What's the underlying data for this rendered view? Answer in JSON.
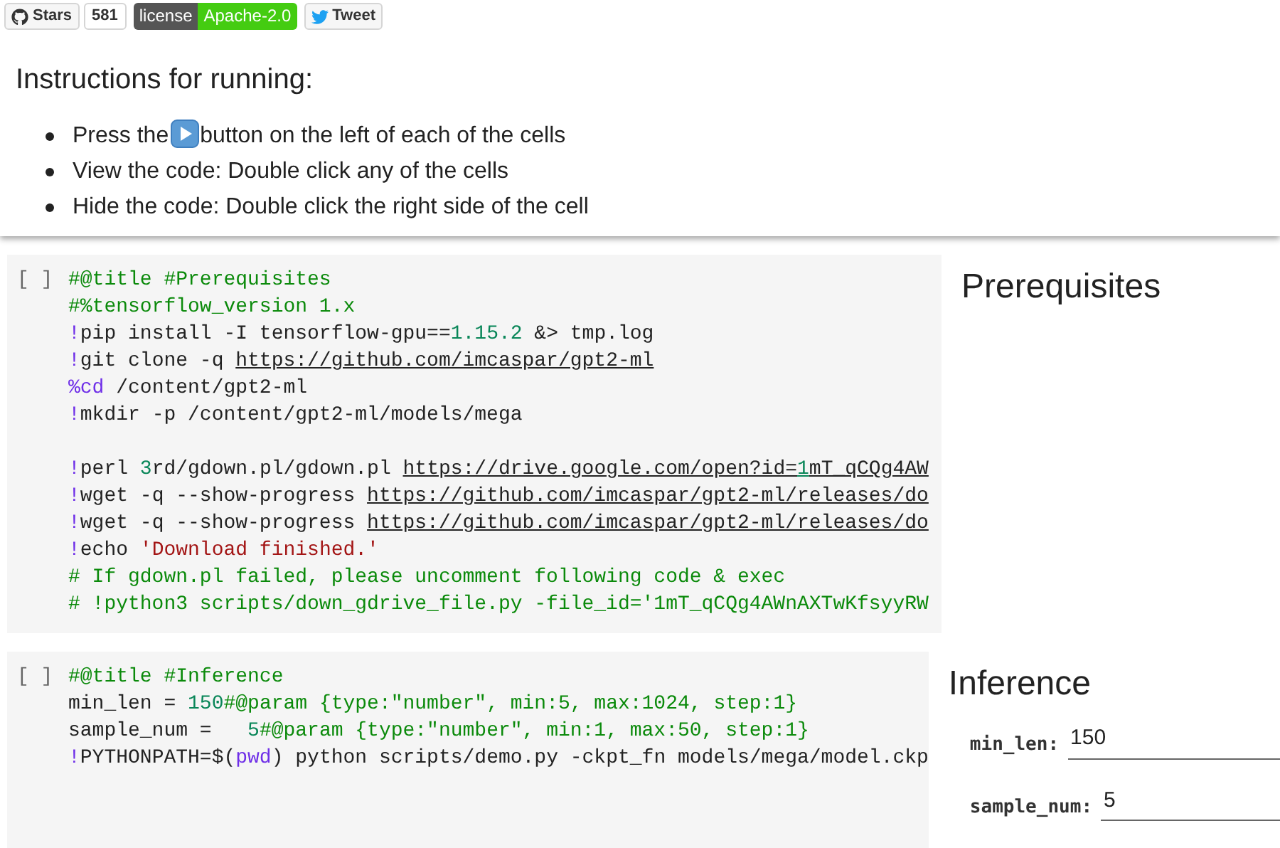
{
  "badges": {
    "stars_label": "Stars",
    "stars_count": "581",
    "license_label": "license",
    "license_value": "Apache-2.0",
    "tweet_label": "Tweet"
  },
  "instructions": {
    "heading": "Instructions for running:",
    "items": [
      {
        "kind": "with_icon",
        "before": "Press the",
        "after": "button on the left of each of the cells"
      },
      {
        "kind": "plain",
        "text": "View the code: Double click any of the cells"
      },
      {
        "kind": "plain",
        "text": "Hide the code: Double click the right side of the cell"
      }
    ]
  },
  "cells": [
    {
      "bracket": "[ ]",
      "title": "Prerequisites",
      "lines": [
        {
          "kind": "code",
          "tokens": [
            {
              "kind": "comment",
              "text": "#@title #Prerequisites"
            }
          ]
        },
        {
          "kind": "code",
          "tokens": [
            {
              "kind": "comment",
              "text": "#%tensorflow_version 1.x"
            }
          ]
        },
        {
          "kind": "code",
          "tokens": [
            {
              "kind": "keyword",
              "text": "!"
            },
            {
              "kind": "plain",
              "text": "pip install -I tensorflow-gpu=="
            },
            {
              "kind": "number",
              "text": "1.15.2"
            },
            {
              "kind": "plain",
              "text": " &> tmp.log"
            }
          ]
        },
        {
          "kind": "code",
          "tokens": [
            {
              "kind": "keyword",
              "text": "!"
            },
            {
              "kind": "plain",
              "text": "git clone -q "
            },
            {
              "kind": "link",
              "text": "https://github.com/imcaspar/gpt2-ml"
            }
          ]
        },
        {
          "kind": "code",
          "tokens": [
            {
              "kind": "keyword",
              "text": "%cd"
            },
            {
              "kind": "plain",
              "text": " /content/gpt2-ml"
            }
          ]
        },
        {
          "kind": "code",
          "tokens": [
            {
              "kind": "keyword",
              "text": "!"
            },
            {
              "kind": "plain",
              "text": "mkdir -p /content/gpt2-ml/models/mega"
            }
          ]
        },
        {
          "kind": "blank"
        },
        {
          "kind": "code",
          "tokens": [
            {
              "kind": "keyword",
              "text": "!"
            },
            {
              "kind": "plain",
              "text": "perl "
            },
            {
              "kind": "number",
              "text": "3"
            },
            {
              "kind": "plain",
              "text": "rd/gdown.pl/gdown.pl "
            },
            {
              "kind": "link",
              "text": "https://drive.google.com/open?id="
            },
            {
              "kind": "link_number",
              "text": "1"
            },
            {
              "kind": "link",
              "text": "mT_qCQg4AW"
            }
          ]
        },
        {
          "kind": "code",
          "tokens": [
            {
              "kind": "keyword",
              "text": "!"
            },
            {
              "kind": "plain",
              "text": "wget -q --show-progress "
            },
            {
              "kind": "link",
              "text": "https://github.com/imcaspar/gpt2-ml/releases/do"
            }
          ]
        },
        {
          "kind": "code",
          "tokens": [
            {
              "kind": "keyword",
              "text": "!"
            },
            {
              "kind": "plain",
              "text": "wget -q --show-progress "
            },
            {
              "kind": "link",
              "text": "https://github.com/imcaspar/gpt2-ml/releases/do"
            }
          ]
        },
        {
          "kind": "code",
          "tokens": [
            {
              "kind": "keyword",
              "text": "!"
            },
            {
              "kind": "plain",
              "text": "echo "
            },
            {
              "kind": "string",
              "text": "'Download finished.'"
            }
          ]
        },
        {
          "kind": "code",
          "tokens": [
            {
              "kind": "comment",
              "text": "# If gdown.pl failed, please uncomment following code & exec"
            }
          ]
        },
        {
          "kind": "code",
          "tokens": [
            {
              "kind": "comment",
              "text": "# !python3 scripts/down_gdrive_file.py -file_id='1mT_qCQg4AWnAXTwKfsyyRW"
            }
          ]
        }
      ]
    },
    {
      "bracket": "[ ]",
      "title": "Inference",
      "lines": [
        {
          "kind": "code",
          "tokens": [
            {
              "kind": "comment",
              "text": "#@title #Inference"
            }
          ]
        },
        {
          "kind": "code",
          "tokens": [
            {
              "kind": "plain",
              "text": "min_len = "
            },
            {
              "kind": "number",
              "text": "150"
            },
            {
              "kind": "comment",
              "text": "#@param {type:\"number\", min:5, max:1024, step:1}"
            }
          ]
        },
        {
          "kind": "code",
          "tokens": [
            {
              "kind": "plain",
              "text": "sample_num =   "
            },
            {
              "kind": "number",
              "text": "5"
            },
            {
              "kind": "comment",
              "text": "#@param {type:\"number\", min:1, max:50, step:1}"
            }
          ]
        },
        {
          "kind": "code",
          "tokens": [
            {
              "kind": "keyword",
              "text": "!"
            },
            {
              "kind": "plain",
              "text": "PYTHONPATH=$("
            },
            {
              "kind": "keyword",
              "text": "pwd"
            },
            {
              "kind": "plain",
              "text": ") python scripts/demo.py -ckpt_fn models/mega/model.ckp"
            }
          ]
        }
      ],
      "fields": [
        {
          "label": "min_len:",
          "value": "150"
        },
        {
          "label": "sample_num:",
          "value": "5"
        }
      ]
    }
  ]
}
